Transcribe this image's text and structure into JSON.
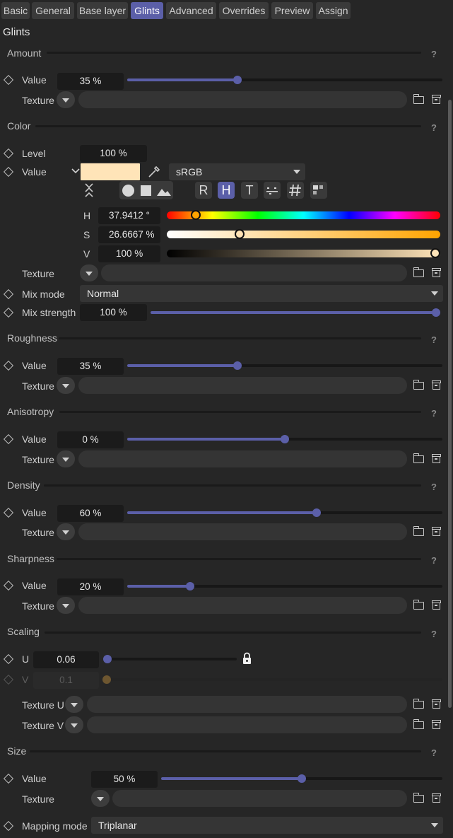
{
  "tabs": [
    "Basic",
    "General",
    "Base layer",
    "Glints",
    "Advanced",
    "Overrides",
    "Preview",
    "Assign"
  ],
  "active_tab": "Glints",
  "title": "Glints",
  "common": {
    "value": "Value",
    "texture": "Texture",
    "help": "?"
  },
  "amount": {
    "title": "Amount",
    "value": "35 %",
    "level": 0.35
  },
  "color": {
    "title": "Color",
    "level_label": "Level",
    "level_value": "100 %",
    "value_label": "Value",
    "swatch": "#ffe4b8",
    "colorspace": "sRGB",
    "modes": [
      "R",
      "H",
      "T"
    ],
    "active_mode": "H",
    "h_label": "H",
    "h_value": "37.9412 °",
    "h_level": 0.105,
    "s_label": "S",
    "s_value": "26.6667 %",
    "s_level": 0.267,
    "v_label": "V",
    "v_value": "100 %",
    "v_level": 1.0,
    "texture": "Texture",
    "mix_mode_label": "Mix mode",
    "mix_mode": "Normal",
    "mix_strength_label": "Mix strength",
    "mix_strength": "100 %",
    "mix_strength_level": 1.0
  },
  "roughness": {
    "title": "Roughness",
    "value": "35 %",
    "level": 0.35
  },
  "anisotropy": {
    "title": "Anisotropy",
    "value": "0 %",
    "level": 0.5
  },
  "density": {
    "title": "Density",
    "value": "60 %",
    "level": 0.6
  },
  "sharpness": {
    "title": "Sharpness",
    "value": "20 %",
    "level": 0.2
  },
  "scaling": {
    "title": "Scaling",
    "u_label": "U",
    "u_value": "0.06",
    "v_label": "V",
    "v_value": "0.1",
    "texture_u": "Texture U",
    "texture_v": "Texture V"
  },
  "size": {
    "title": "Size",
    "value": "50 %",
    "level": 0.5
  },
  "mapping": {
    "label": "Mapping mode",
    "value": "Triplanar"
  },
  "colors": {
    "accent": "#5b5fa8",
    "background": "#262626"
  }
}
